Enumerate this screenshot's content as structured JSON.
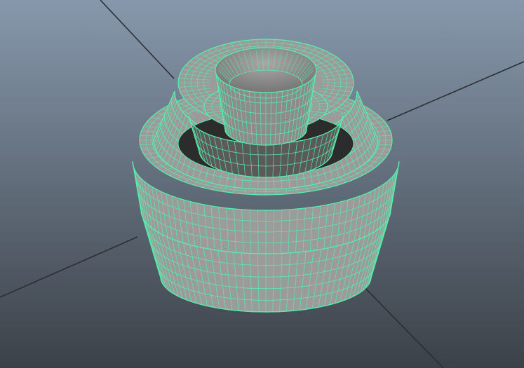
{
  "viewport": {
    "background_top": "#8798ac",
    "background_bottom": "#3b4148",
    "grid_line_color": "#2b2f33",
    "wireframe_color": "#55f0ad",
    "surface_color": "#9b9b9b",
    "surface_shadow_color": "#6f6f6f",
    "interior_dark_color": "#2c2c2c"
  },
  "model": {
    "object_type": "stacked-lathe-mesh",
    "display_mode": "shaded-with-wireframe",
    "selected": true
  }
}
